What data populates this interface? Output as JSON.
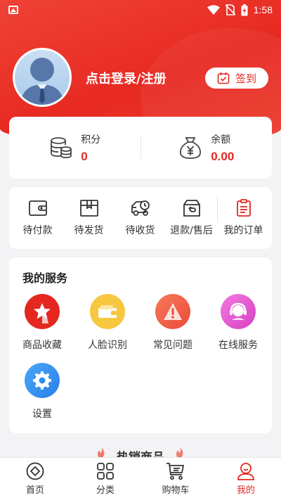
{
  "status_bar": {
    "time": "1:58"
  },
  "profile": {
    "login_text": "点击登录/注册",
    "signin_label": "签到"
  },
  "stats": [
    {
      "label": "积分",
      "value": "0",
      "icon": "coins-icon"
    },
    {
      "label": "余额",
      "value": "0.00",
      "icon": "money-bag-icon"
    }
  ],
  "orders": [
    {
      "label": "待付款",
      "icon": "wallet-icon"
    },
    {
      "label": "待发货",
      "icon": "box-icon"
    },
    {
      "label": "待收货",
      "icon": "truck-icon"
    },
    {
      "label": "退款/售后",
      "icon": "refund-icon"
    },
    {
      "label": "我的订单",
      "icon": "order-list-icon"
    }
  ],
  "services": {
    "title": "我的服务",
    "items": [
      {
        "label": "商品收藏",
        "icon": "star-icon",
        "color": "#e4271f"
      },
      {
        "label": "人脸识别",
        "icon": "wallet-card-icon",
        "color": "#f7c740"
      },
      {
        "label": "常见问题",
        "icon": "alert-icon",
        "color": "#f05a40"
      },
      {
        "label": "在线服务",
        "icon": "headset-icon",
        "color": "#e84fd0"
      },
      {
        "label": "设置",
        "icon": "gear-icon",
        "color": "#2f8ff0"
      }
    ]
  },
  "hot_products": {
    "title": "热销商品"
  },
  "tabbar": {
    "items": [
      {
        "label": "首页",
        "icon": "home-diamond-icon",
        "active": false
      },
      {
        "label": "分类",
        "icon": "grid-icon",
        "active": false
      },
      {
        "label": "购物车",
        "icon": "cart-icon",
        "active": false
      },
      {
        "label": "我的",
        "icon": "user-icon",
        "active": true
      }
    ]
  },
  "colors": {
    "brand_red": "#e4271f",
    "background": "#f3f3f5"
  }
}
